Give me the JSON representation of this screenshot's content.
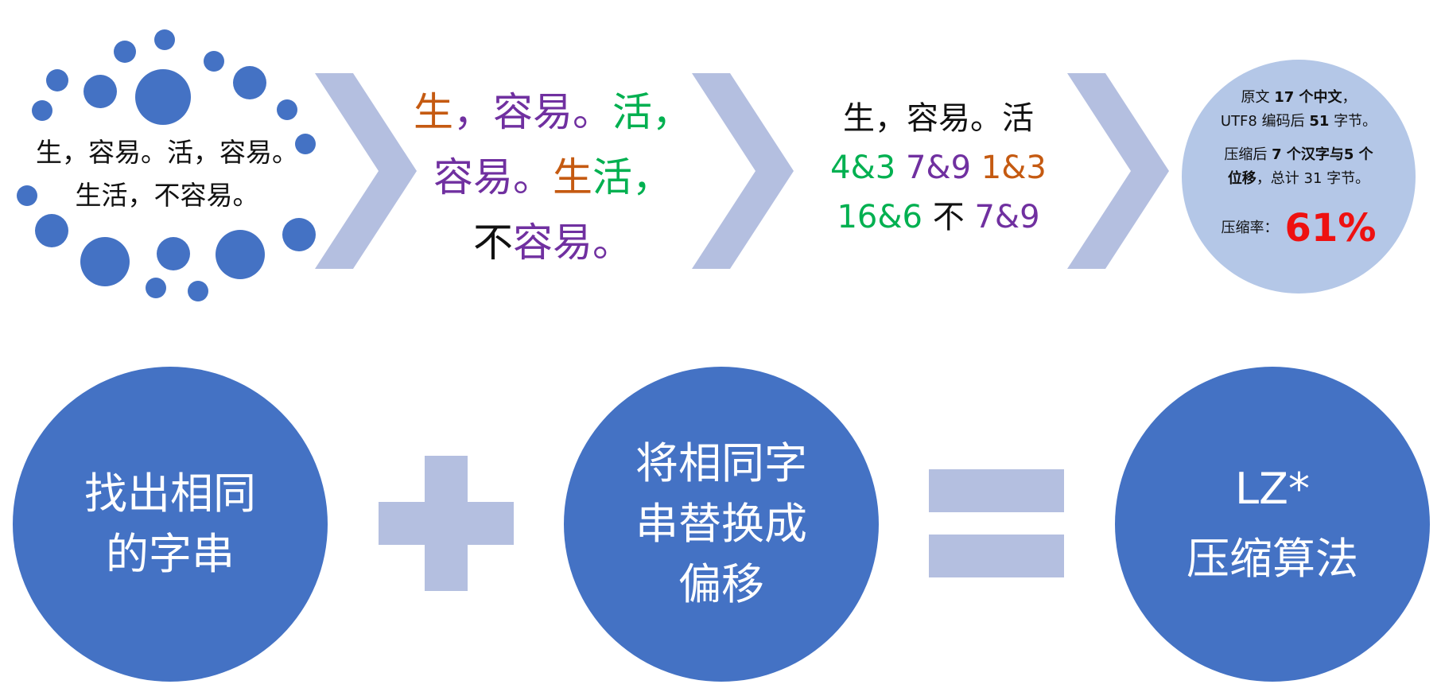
{
  "input_text": {
    "line1": "生，容易。活，容易。",
    "line2": "生活，不容易。"
  },
  "highlighted_text": {
    "line1": [
      {
        "text": "生",
        "color": "#c55a11"
      },
      {
        "text": "，容易。",
        "color": "#7030a0"
      },
      {
        "text": "活，",
        "color": "#00b050"
      }
    ],
    "line2": [
      {
        "text": "容易。",
        "color": "#7030a0"
      },
      {
        "text": "生",
        "color": "#c55a11"
      },
      {
        "text": "活，",
        "color": "#00b050"
      }
    ],
    "line3": [
      {
        "text": "不",
        "color": "#111111"
      },
      {
        "text": "容易。",
        "color": "#7030a0"
      }
    ]
  },
  "encoded_text": {
    "line1": "生，容易。活",
    "line2": [
      {
        "text": "4&3",
        "color": "#00b050"
      },
      {
        "text": "7&9",
        "color": "#7030a0"
      },
      {
        "text": "1&3",
        "color": "#c55a11"
      }
    ],
    "line3": [
      {
        "text": "16&6",
        "color": "#00b050"
      },
      {
        "text": "不",
        "color": "#111111"
      },
      {
        "text": "7&9",
        "color": "#7030a0"
      }
    ]
  },
  "info": {
    "l1_a": "原文 ",
    "l1_b": "17 个中文",
    "l1_c": "，",
    "l2_a": "UTF8 编码后 ",
    "l2_b": "51",
    "l2_c": " 字节。",
    "l3_a": "压缩后 ",
    "l3_b": "7 个汉字与5 个",
    "l4_a": "位移",
    "l4_b": "，总计 31 字节。",
    "rate_label": "压缩率：",
    "rate_value": "61%"
  },
  "equation": {
    "find": [
      "找出相同",
      "的字串"
    ],
    "replace": [
      "将相同字",
      "串替换成",
      "偏移"
    ],
    "result": [
      "LZ*",
      "压缩算法"
    ]
  },
  "colors": {
    "circle_blue": "#4472c4",
    "light_blue": "#b4c7e7",
    "chevron": "#b4bfe0",
    "highlight_red": "#ee1111"
  }
}
